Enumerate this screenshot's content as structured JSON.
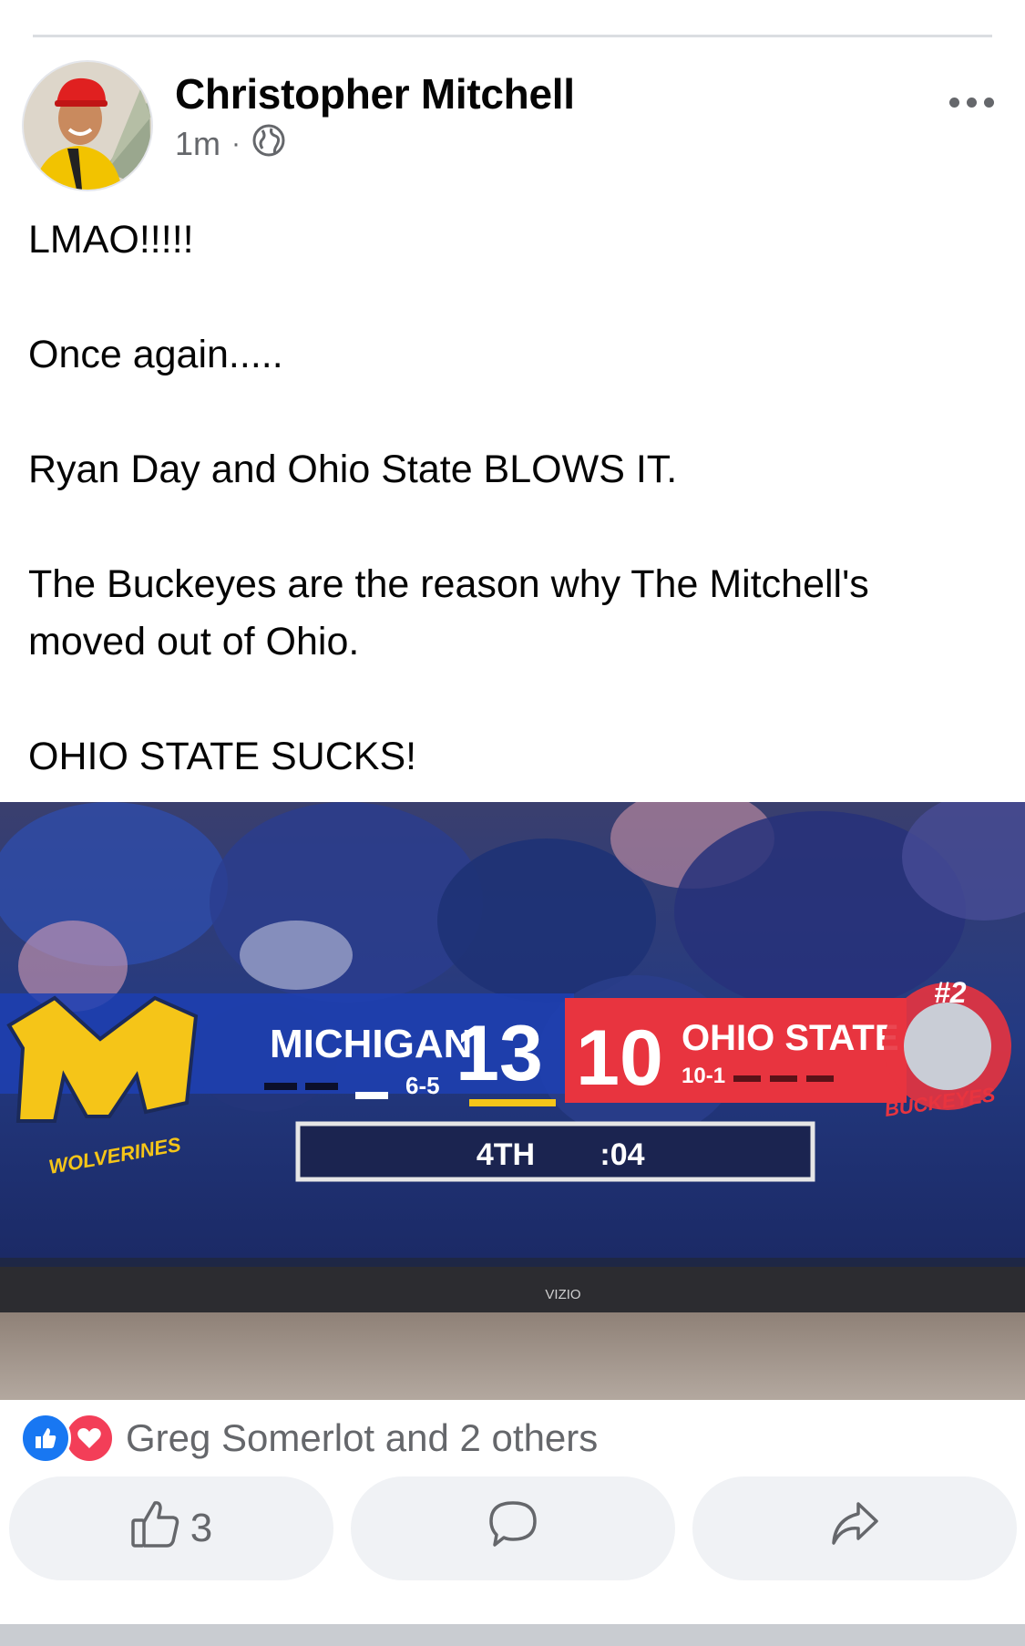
{
  "post": {
    "author": "Christopher Mitchell",
    "time": "1m",
    "separator": "·",
    "audience_icon": "globe-icon",
    "text": [
      "LMAO!!!!!",
      "",
      "Once again.....",
      "",
      "Ryan Day and Ohio State BLOWS IT.",
      "",
      "The Buckeyes are the reason why The Mitchell's",
      "moved out of Ohio.",
      "",
      "OHIO STATE SUCKS!"
    ]
  },
  "photo": {
    "scoreboard": {
      "team1_name": "MICHIGAN",
      "team1_record": "6-5",
      "team1_score": "13",
      "team2_score": "10",
      "team2_name": "OHIO STATE",
      "team2_record": "10-1",
      "team2_rank": "#2",
      "period": "4TH",
      "clock": ":04",
      "team1_logo_text": "WOLVERINES",
      "team2_logo_text": "BUCKEYES"
    },
    "tv_brand": "VIZIO"
  },
  "reactions": {
    "summary": "Greg Somerlot and 2 others",
    "icons": [
      "like-icon",
      "love-icon"
    ]
  },
  "actions": {
    "like_count": "3",
    "icons": [
      "thumbs-up-icon",
      "comment-icon",
      "share-icon"
    ]
  },
  "colors": {
    "accent_blue": "#1877f2",
    "love_red": "#f33e58",
    "michigan_maize": "#f5c518",
    "ohio_state_red": "#e8343f"
  }
}
